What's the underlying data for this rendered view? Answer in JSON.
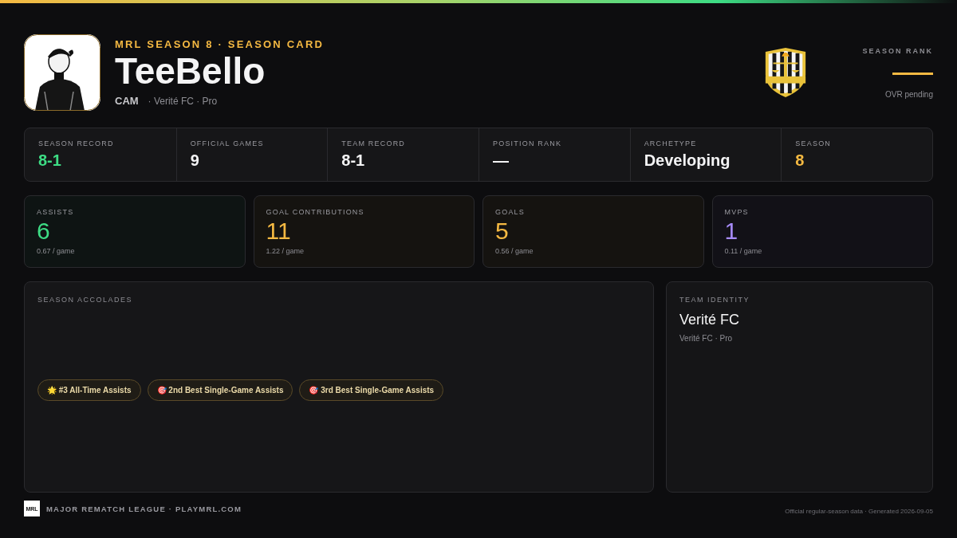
{
  "header": {
    "eyebrow": "MRL SEASON 8 · SEASON CARD",
    "player_name": "TeeBello",
    "position": "CAM",
    "team_line": "· Verité FC · Pro"
  },
  "season_rank": {
    "label": "SEASON RANK",
    "value": "—",
    "note": "OVR pending"
  },
  "summary": [
    {
      "label": "SEASON RECORD",
      "value": "8-1",
      "color": "#3ddc84"
    },
    {
      "label": "OFFICIAL GAMES",
      "value": "9",
      "color": "#f4f4f5"
    },
    {
      "label": "TEAM RECORD",
      "value": "8-1",
      "color": "#f4f4f5"
    },
    {
      "label": "POSITION RANK",
      "value": "—",
      "color": "#f4f4f5"
    },
    {
      "label": "ARCHETYPE",
      "value": "Developing",
      "color": "#f4f4f5"
    },
    {
      "label": "SEASON",
      "value": "8",
      "color": "#f5b942"
    }
  ],
  "metrics": [
    {
      "label": "ASSISTS",
      "value": "6",
      "per_game": "0.67 / game",
      "color": "#3ddc84"
    },
    {
      "label": "GOAL CONTRIBUTIONS",
      "value": "11",
      "per_game": "1.22 / game",
      "color": "#f5b942"
    },
    {
      "label": "GOALS",
      "value": "5",
      "per_game": "0.56 / game",
      "color": "#f5b942"
    },
    {
      "label": "MVPS",
      "value": "1",
      "per_game": "0.11 / game",
      "color": "#a78bfa"
    }
  ],
  "accolades": {
    "title": "SEASON ACCOLADES",
    "items": [
      {
        "icon": "🌟",
        "text": "#3 All-Time Assists"
      },
      {
        "icon": "🎯",
        "text": "2nd Best Single-Game Assists"
      },
      {
        "icon": "🎯",
        "text": "3rd Best Single-Game Assists"
      }
    ]
  },
  "team_identity": {
    "title": "TEAM IDENTITY",
    "name": "Verité FC",
    "detail": "Verité FC · Pro"
  },
  "footer": {
    "logo_text": "MRL",
    "brand": "MAJOR REMATCH LEAGUE · PLAYMRL.COM",
    "note": "Official regular-season data · Generated 2026-09-05"
  }
}
